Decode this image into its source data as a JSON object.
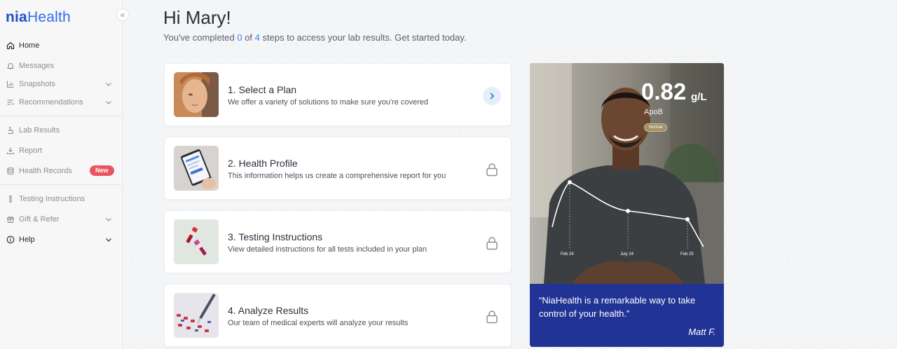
{
  "brand": {
    "logo_part1": "nia",
    "logo_part2": "Health"
  },
  "sidebar": {
    "collapse_label": "«",
    "items": [
      {
        "label": "Home"
      },
      {
        "label": "Messages"
      },
      {
        "label": "Snapshots"
      },
      {
        "label": "Recommendations"
      },
      {
        "label": "Lab Results"
      },
      {
        "label": "Report"
      },
      {
        "label": "Health Records",
        "badge": "New"
      },
      {
        "label": "Testing Instructions"
      },
      {
        "label": "Gift & Refer"
      },
      {
        "label": "Help"
      }
    ]
  },
  "header": {
    "greeting": "Hi Mary!",
    "progress_prefix": "You've completed ",
    "completed": "0",
    "progress_mid": " of ",
    "total": "4",
    "progress_suffix": " steps to access your lab results. Get started today."
  },
  "steps": [
    {
      "title": "1. Select a Plan",
      "description": "We offer a variety of solutions to make sure you're covered",
      "action": "arrow"
    },
    {
      "title": "2. Health Profile",
      "description": "This information helps us create a comprehensive report for you",
      "action": "locked"
    },
    {
      "title": "3. Testing Instructions",
      "description": "View detailed instructions for all tests included in your plan",
      "action": "locked"
    },
    {
      "title": "4. Analyze Results",
      "description": "Our team of medical experts will analyze your results",
      "action": "locked"
    }
  ],
  "testimonial": {
    "metric_value": "0.82",
    "metric_unit": "g/L",
    "metric_label": "ApoB",
    "metric_status": "Normal",
    "dates": [
      "Feb 24",
      "July 24",
      "Feb 25"
    ],
    "quote": "“NiaHealth is a remarkable way to take control of your health.”",
    "author": "Matt F."
  },
  "colors": {
    "brand_dark": "#1e50c8",
    "brand_light": "#2f6ee8",
    "accent_number": "#3a86e6",
    "badge_new": "#e9555e",
    "quote_bg": "#213394"
  }
}
